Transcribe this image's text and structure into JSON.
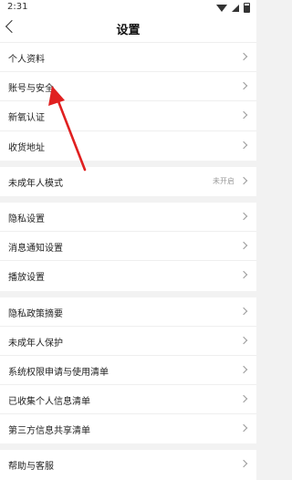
{
  "status": {
    "time": "2:31"
  },
  "nav": {
    "title": "设置"
  },
  "groups": [
    {
      "rows": [
        {
          "label": "个人资料"
        },
        {
          "label": "账号与安全"
        },
        {
          "label": "新氧认证"
        },
        {
          "label": "收货地址"
        }
      ]
    },
    {
      "rows": [
        {
          "label": "未成年人模式",
          "value": "未开启"
        }
      ]
    },
    {
      "rows": [
        {
          "label": "隐私设置"
        },
        {
          "label": "消息通知设置"
        },
        {
          "label": "播放设置"
        }
      ]
    },
    {
      "rows": [
        {
          "label": "隐私政策摘要"
        },
        {
          "label": "未成年人保护"
        },
        {
          "label": "系统权限申请与使用清单"
        },
        {
          "label": "已收集个人信息清单"
        },
        {
          "label": "第三方信息共享清单"
        }
      ]
    },
    {
      "rows": [
        {
          "label": "帮助与客服"
        }
      ]
    }
  ],
  "colors": {
    "annotation_arrow": "#e02020"
  }
}
